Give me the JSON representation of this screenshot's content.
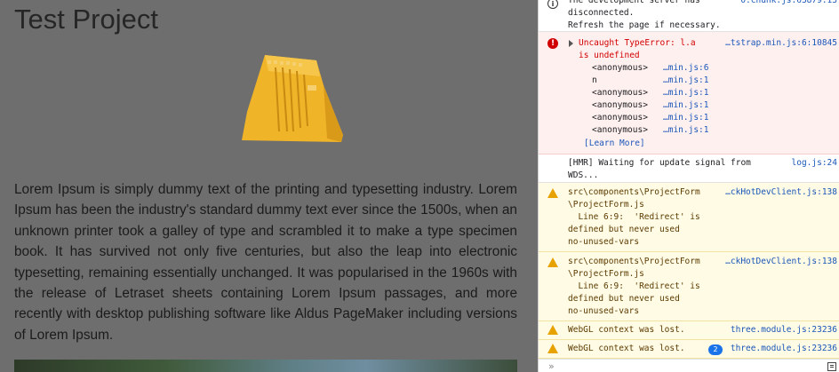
{
  "page": {
    "title": "Test Project",
    "body_text": "Lorem Ipsum is simply dummy text of the printing and typesetting industry. Lorem Ipsum has been the industry's standard dummy text ever since the 1500s, when an unknown printer took a galley of type and scrambled it to make a type specimen book. It has survived not only five centuries, but also the leap into electronic typesetting, remaining essentially unchanged. It was popularised in the 1960s with the release of Letraset sheets containing Lorem Ipsum passages, and more recently with desktop publishing software like Aldus PageMaker including versions of Lorem Ipsum.",
    "model_color": "#f0b429"
  },
  "console": {
    "messages": [
      {
        "level": "info",
        "text": "The development server has\ndisconnected.\nRefresh the page if necessary.",
        "source": "0.chunk.js:63879:13"
      },
      {
        "level": "error",
        "text": "Uncaught TypeError: l.a\nis undefined",
        "source": "…tstrap.min.js:6:10845",
        "stack": [
          {
            "fn": "<anonymous>",
            "loc": "…min.js:6"
          },
          {
            "fn": "n",
            "loc": "…min.js:1"
          },
          {
            "fn": "<anonymous>",
            "loc": "…min.js:1"
          },
          {
            "fn": "<anonymous>",
            "loc": "…min.js:1"
          },
          {
            "fn": "<anonymous>",
            "loc": "…min.js:1"
          },
          {
            "fn": "<anonymous>",
            "loc": "…min.js:1"
          }
        ],
        "learn_more": "[Learn More]"
      },
      {
        "level": "log",
        "text": "[HMR] Waiting for update signal from\nWDS...",
        "source": "log.js:24"
      },
      {
        "level": "warning",
        "text": "src\\components\\ProjectForm\n\\ProjectForm.js\n  Line 6:9:  'Redirect' is\ndefined but never used\nno-unused-vars",
        "source": "…ckHotDevClient.js:138"
      },
      {
        "level": "warning",
        "text": "src\\components\\ProjectForm\n\\ProjectForm.js\n  Line 6:9:  'Redirect' is\ndefined but never used\nno-unused-vars",
        "source": "…ckHotDevClient.js:138"
      },
      {
        "level": "warning",
        "text": "WebGL context was lost.",
        "source": "three.module.js:23236"
      },
      {
        "level": "warning",
        "text": "WebGL context was lost.",
        "source": "three.module.js:23236",
        "repeat_count": "2"
      }
    ],
    "prompt_symbol": "»",
    "colors": {
      "error": "#d10000",
      "warning": "#e8a200",
      "link": "#1a56b8"
    }
  }
}
